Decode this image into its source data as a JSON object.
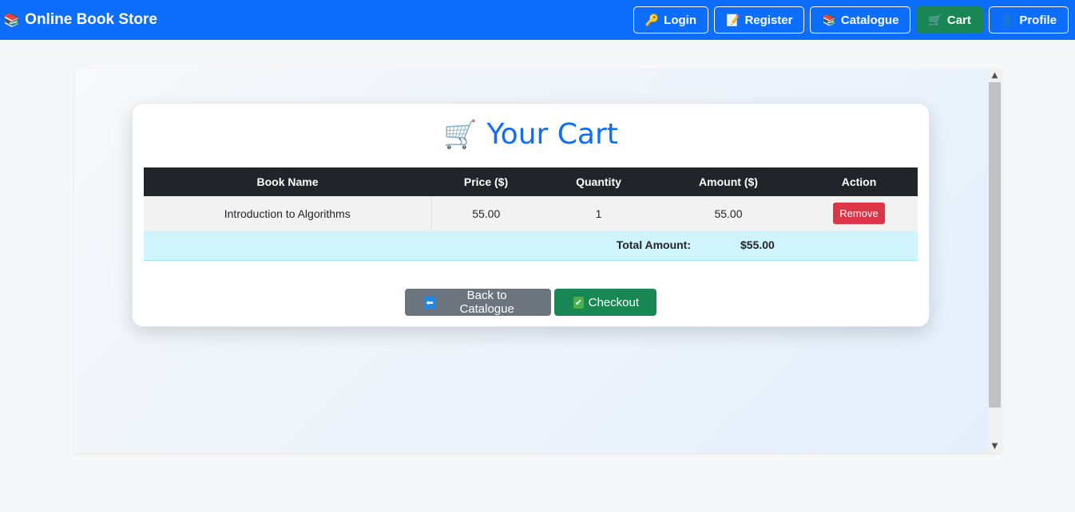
{
  "navbar": {
    "brand_icon": "📚",
    "brand": "Online Book Store",
    "buttons": [
      {
        "label": "Login",
        "icon": "🔑"
      },
      {
        "label": "Register",
        "icon": "📝"
      },
      {
        "label": "Catalogue",
        "icon": "📚"
      },
      {
        "label": "Cart",
        "icon": "🛒",
        "active": true
      },
      {
        "label": "Profile",
        "icon": "👤"
      }
    ]
  },
  "cart": {
    "icon": "🛒",
    "title": "Your Cart",
    "columns": [
      "Book Name",
      "Price ($)",
      "Quantity",
      "Amount ($)",
      "Action"
    ],
    "items": [
      {
        "name": "Introduction to Algorithms",
        "price": "55.00",
        "quantity": "1",
        "amount": "55.00",
        "action": "Remove"
      }
    ],
    "total_label": "Total Amount:",
    "total_value": "$55.00",
    "back_label": "Back to Catalogue",
    "back_icon": "⬅",
    "checkout_label": "Checkout",
    "checkout_icon": "✔"
  },
  "colors": {
    "primary": "#0d6efd",
    "success": "#198754",
    "danger": "#dc3545",
    "secondary": "#6c757d",
    "table_header": "#212529",
    "total_row": "#cff4fc"
  }
}
